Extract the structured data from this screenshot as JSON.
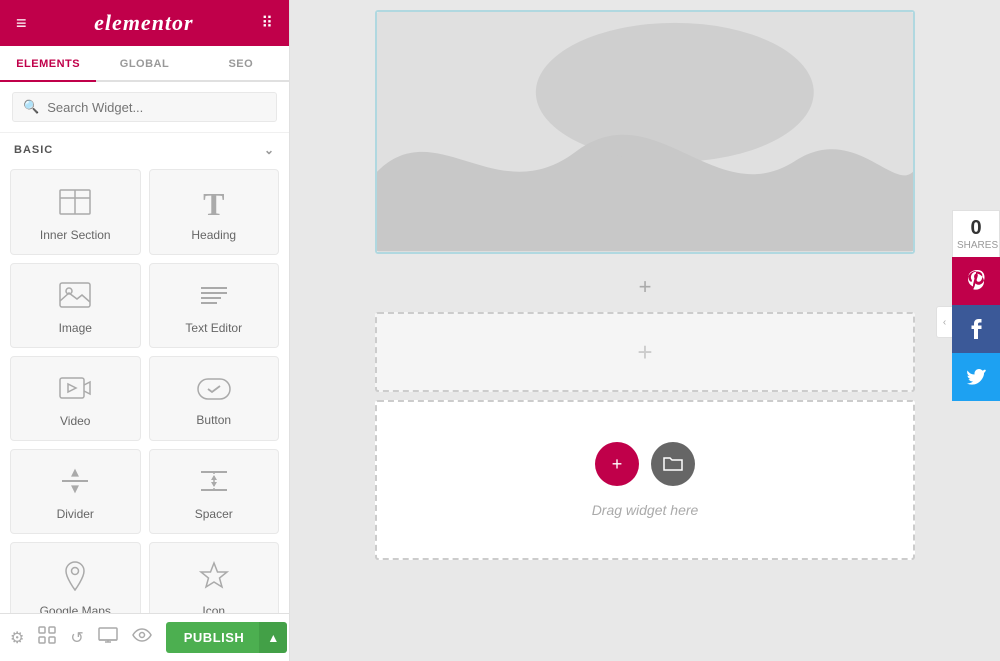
{
  "header": {
    "logo": "elementor",
    "hamburger_icon": "≡",
    "grid_icon": "⠿"
  },
  "tabs": [
    {
      "id": "elements",
      "label": "ELEMENTS",
      "active": true
    },
    {
      "id": "global",
      "label": "GLOBAL",
      "active": false
    },
    {
      "id": "seo",
      "label": "SEO",
      "active": false
    }
  ],
  "search": {
    "placeholder": "Search Widget..."
  },
  "basic_section": {
    "label": "BASIC",
    "chevron": "⌄"
  },
  "widgets": [
    {
      "id": "inner-section",
      "label": "Inner Section",
      "icon": "▦"
    },
    {
      "id": "heading",
      "label": "Heading",
      "icon": "T"
    },
    {
      "id": "image",
      "label": "Image",
      "icon": "🖼"
    },
    {
      "id": "text-editor",
      "label": "Text Editor",
      "icon": "≡"
    },
    {
      "id": "video",
      "label": "Video",
      "icon": "▶"
    },
    {
      "id": "button",
      "label": "Button",
      "icon": "⬡"
    },
    {
      "id": "divider",
      "label": "Divider",
      "icon": "⇕"
    },
    {
      "id": "spacer",
      "label": "Spacer",
      "icon": "↕"
    },
    {
      "id": "google-maps",
      "label": "Google Maps",
      "icon": "📍"
    },
    {
      "id": "icon",
      "label": "Icon",
      "icon": "★"
    }
  ],
  "footer": {
    "icons": [
      "⚙",
      "⬡",
      "↺",
      "🖥",
      "👁"
    ],
    "publish_label": "PUBLISH",
    "arrow_label": "▲"
  },
  "social_share": {
    "count": "0",
    "count_label": "Shares",
    "collapse_arrow": "‹",
    "buttons": [
      {
        "id": "pinterest",
        "icon": "P"
      },
      {
        "id": "facebook",
        "icon": "f"
      },
      {
        "id": "twitter",
        "icon": "t"
      }
    ]
  },
  "canvas": {
    "add_section_icon": "+",
    "drag_widget_text": "Drag widget here",
    "drag_plus_icon": "+",
    "drag_folder_icon": "▣"
  },
  "colors": {
    "brand": "#c0004a",
    "sidebar_bg": "#ffffff",
    "canvas_bg": "#e8e8e8",
    "pinterest": "#c0004a",
    "facebook": "#3b5998",
    "twitter": "#1da1f2",
    "publish_green": "#4caf50"
  }
}
